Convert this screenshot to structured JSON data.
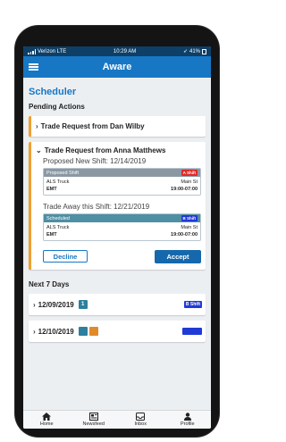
{
  "status_bar": {
    "carrier": "Verizon LTE",
    "time": "10:29 AM",
    "battery": "41%"
  },
  "app_bar": {
    "title": "Aware"
  },
  "page": {
    "title": "Scheduler"
  },
  "pending": {
    "title": "Pending Actions",
    "collapsed_request": "Trade Request from Dan Wilby",
    "expanded_request": {
      "title": "Trade Request from Anna Matthews",
      "proposed_label": "Proposed New Shift: 12/14/2019",
      "proposed_shift": {
        "header": "Proposed Shift",
        "badge": "A Shift",
        "badge_color": "#e02a2a",
        "unit": "ALS Truck",
        "location": "Main St",
        "role": "EMT",
        "hours": "19:00-07:00"
      },
      "away_label": "Trade Away this Shift: 12/21/2019",
      "scheduled_shift": {
        "header": "Scheduled",
        "badge": "B Shift",
        "badge_color": "#2238d6",
        "unit": "ALS Truck",
        "location": "Main St",
        "role": "EMT",
        "hours": "19:00-07:00"
      },
      "decline_label": "Decline",
      "accept_label": "Accept"
    }
  },
  "next_days": {
    "title": "Next 7 Days",
    "items": [
      {
        "date": "12/09/2019",
        "count": "1",
        "shift": "B Shift"
      },
      {
        "date": "12/10/2019",
        "count": "",
        "shift": ""
      }
    ]
  },
  "bottom_nav": {
    "home": "Home",
    "newsfeed": "Newsfeed",
    "inbox": "Inbox",
    "profile": "Profile"
  },
  "colors": {
    "primary": "#1777c4",
    "accent": "#f0a030",
    "status_bar": "#0e3f67"
  }
}
